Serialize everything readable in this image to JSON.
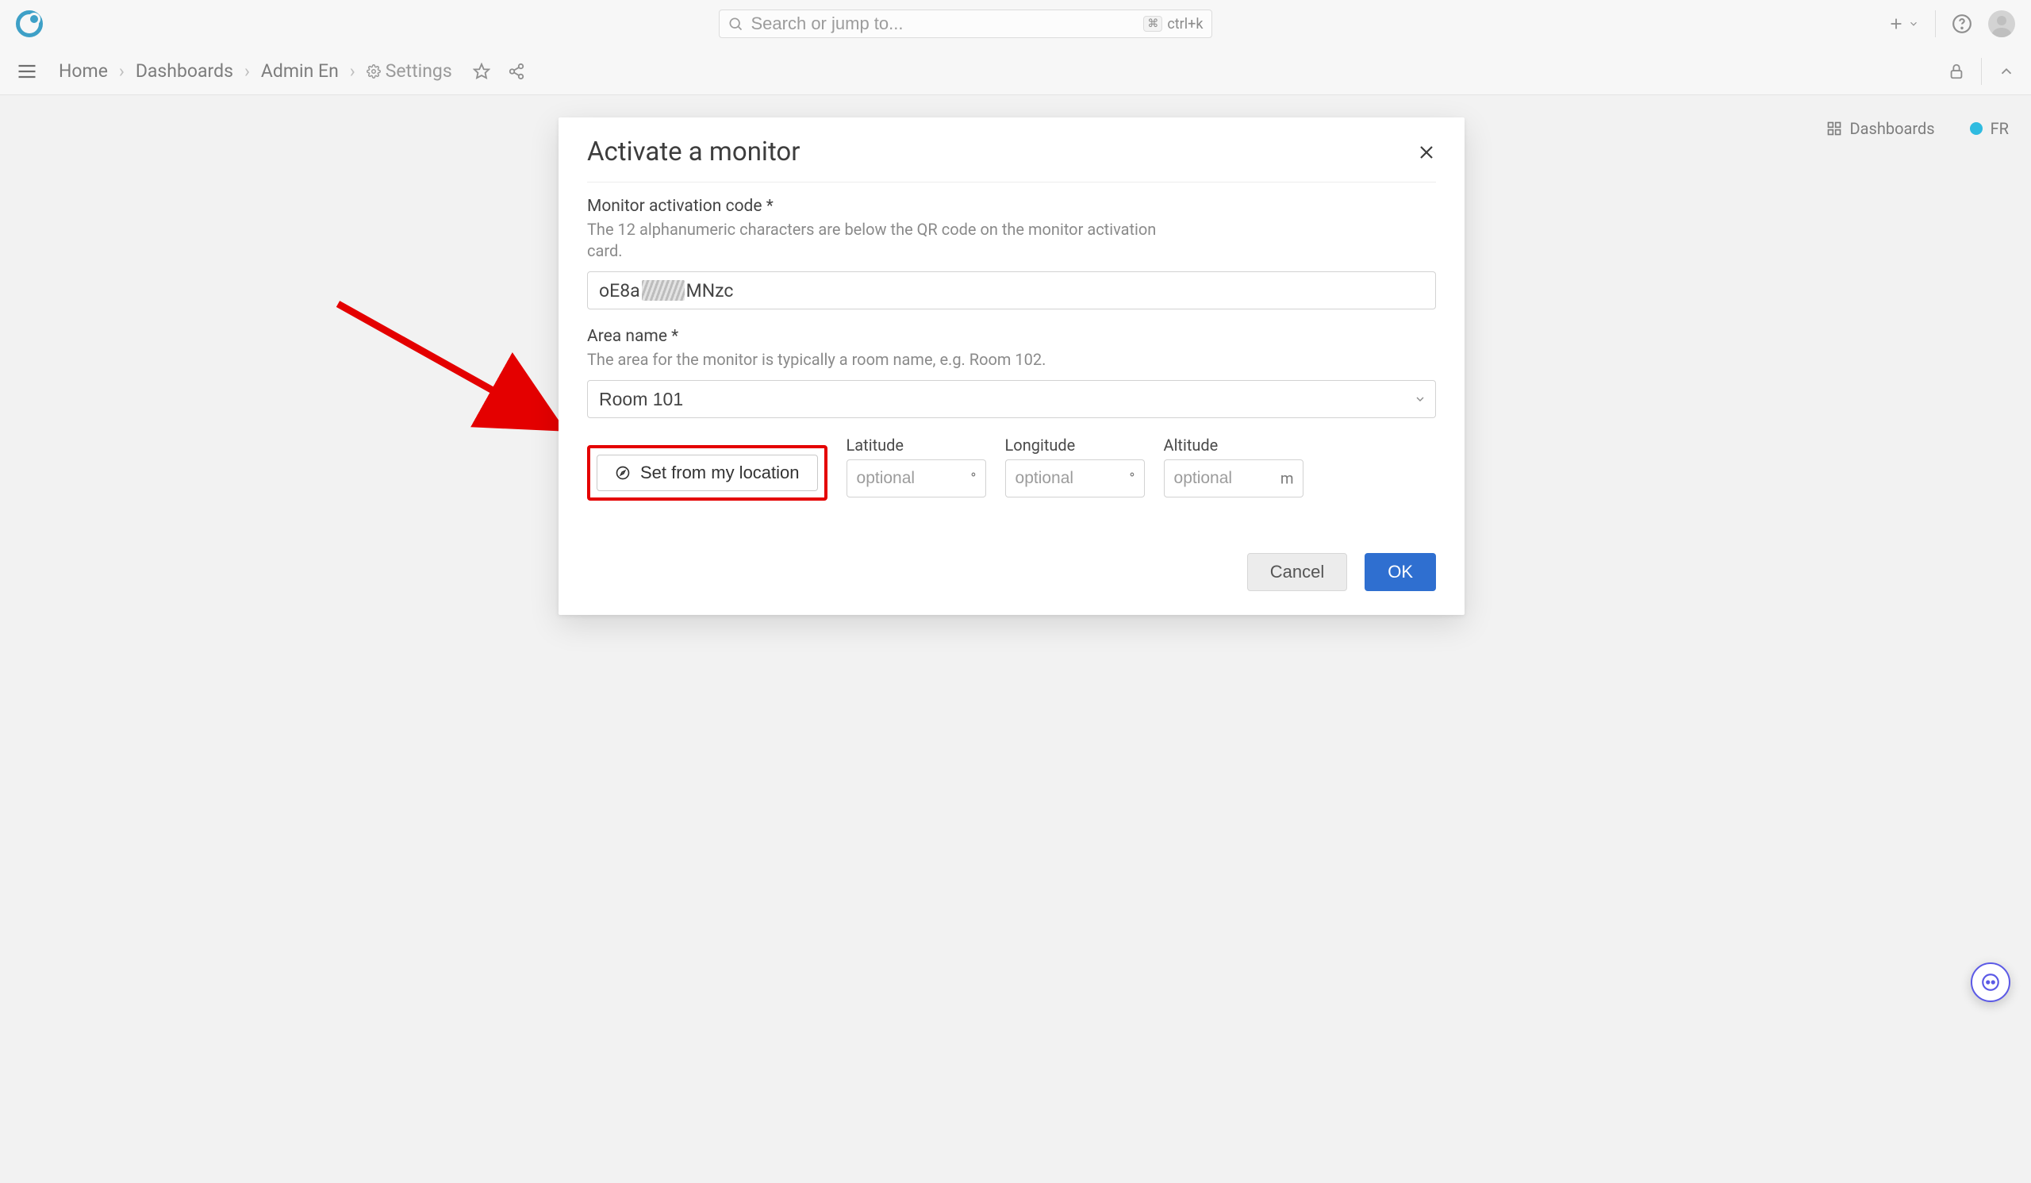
{
  "header": {
    "search_placeholder": "Search or jump to...",
    "kbd_hint": "ctrl+k"
  },
  "breadcrumbs": {
    "items": [
      "Home",
      "Dashboards",
      "Admin En",
      "Settings"
    ]
  },
  "page_widgets": {
    "dashboards_label": "Dashboards",
    "lang_code": "FR"
  },
  "dialog": {
    "title": "Activate a monitor",
    "code_label": "Monitor activation code *",
    "code_hint": "The 12 alphanumeric characters are below the QR code on the monitor activation card.",
    "code_prefix": "oE8a",
    "code_suffix": "MNzc",
    "area_label": "Area name *",
    "area_hint": "The area for the monitor is typically a room name, e.g. Room 102.",
    "area_value": "Room 101",
    "set_location_label": "Set from my location",
    "coords": {
      "lat_label": "Latitude",
      "lat_placeholder": "optional",
      "lat_unit": "°",
      "lon_label": "Longitude",
      "lon_placeholder": "optional",
      "lon_unit": "°",
      "alt_label": "Altitude",
      "alt_placeholder": "optional",
      "alt_unit": "m"
    },
    "cancel_label": "Cancel",
    "ok_label": "OK"
  }
}
